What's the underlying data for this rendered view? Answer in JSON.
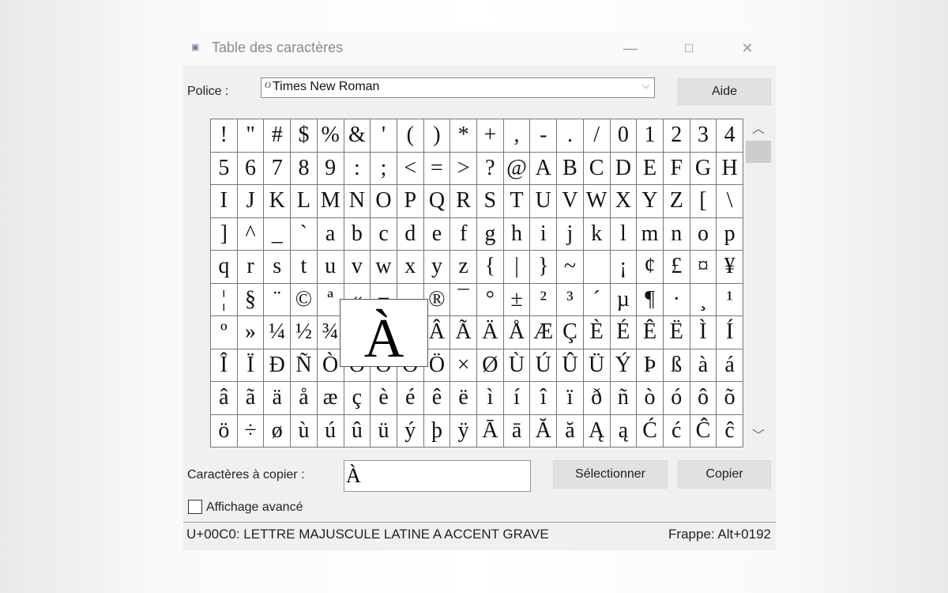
{
  "window": {
    "title": "Table des caractères",
    "minimize": "—",
    "maximize": "☐",
    "close": "✕"
  },
  "font": {
    "label": "Police :",
    "value": "Times New Roman",
    "type_glyph": "O"
  },
  "help_button": "Aide",
  "grid": {
    "rows": [
      "!\"#$%&'()*+,-./01234",
      "56789:;<=>?@ABCDEFGH",
      "IJKLMNOPQRSTUVWXYZ[\\",
      "]^_`abcdefghijklmnop",
      "qrstuvwxyz{|}~ ¡¢£¤¥",
      "¦§¨©ª«¬­®¯°±²³´µ¶·¸¹",
      "º»¼½¾¿ÀÁÂÃÄÅÆÇÈÉÊËÌÍ",
      "ÎÏÐÑÒÓÔÕÖ×ØÙÚÛÜÝÞßàá",
      "âãäåæçèéêëìíîïðñòóôõ",
      "ö÷øùúûüýþÿĀāĂăĄąĆćĈĉ"
    ],
    "selected": "À"
  },
  "copy": {
    "label": "Caractères à copier :",
    "value": "À",
    "select_button": "Sélectionner",
    "copy_button": "Copier"
  },
  "advanced": {
    "label": "Affichage avancé",
    "checked": false
  },
  "status": {
    "description": "U+00C0: LETTRE MAJUSCULE LATINE A ACCENT GRAVE",
    "keystroke": "Frappe: Alt+0192"
  }
}
